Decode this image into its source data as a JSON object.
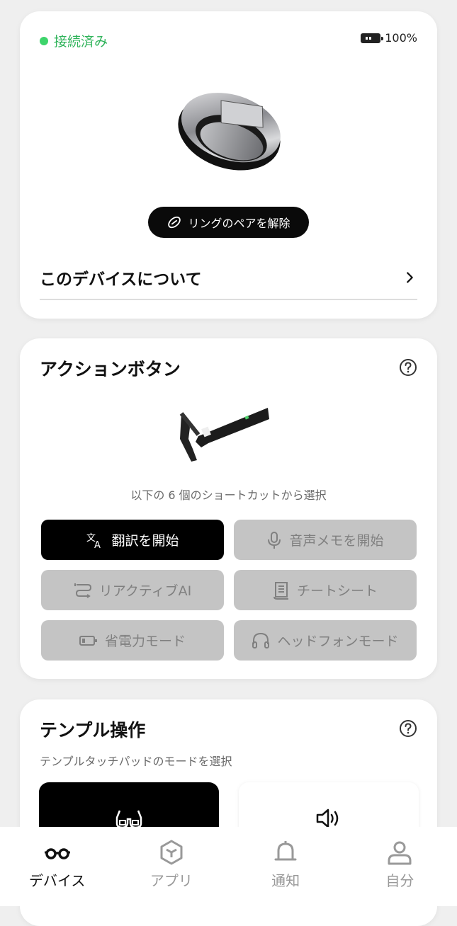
{
  "device": {
    "status_label": "接続済み",
    "status_color": "#3dd46b",
    "battery_label": "100%",
    "battery_level": 1.0,
    "unpair_label": "リングのペアを解除",
    "about_label": "このデバイスについて"
  },
  "action": {
    "title": "アクションボタン",
    "hint": "以下の 6 個のショートカットから選択",
    "shortcuts": [
      {
        "label": "翻訳を開始",
        "icon": "translate-icon",
        "active": true
      },
      {
        "label": "音声メモを開始",
        "icon": "microphone-icon",
        "active": false
      },
      {
        "label": "リアクティブAI",
        "icon": "reactive-ai-icon",
        "active": false
      },
      {
        "label": "チートシート",
        "icon": "document-icon",
        "active": false
      },
      {
        "label": "省電力モード",
        "icon": "battery-low-icon",
        "active": false
      },
      {
        "label": "ヘッドフォンモード",
        "icon": "headphones-icon",
        "active": false
      }
    ]
  },
  "temple": {
    "title": "テンプル操作",
    "subtitle": "テンプルタッチパッドのモードを選択",
    "tiles": [
      {
        "icon": "glasses-display-icon",
        "selected": true
      },
      {
        "icon": "speaker-icon",
        "selected": false
      }
    ]
  },
  "nav": {
    "items": [
      {
        "label": "デバイス",
        "icon": "glasses-icon",
        "active": true
      },
      {
        "label": "アプリ",
        "icon": "app-cube-icon",
        "active": false
      },
      {
        "label": "通知",
        "icon": "bell-icon",
        "active": false
      },
      {
        "label": "自分",
        "icon": "person-icon",
        "active": false
      }
    ]
  }
}
